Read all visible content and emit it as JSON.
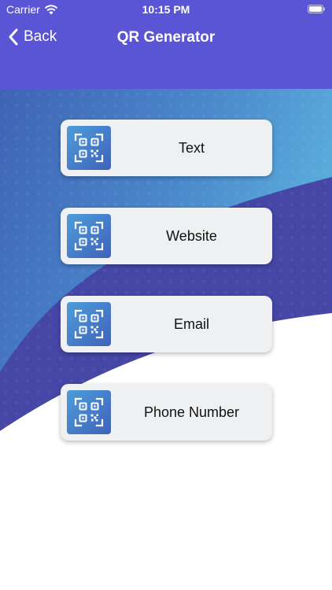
{
  "status_bar": {
    "carrier": "Carrier",
    "time": "10:15 PM",
    "icons": [
      "wifi-icon",
      "battery-icon"
    ]
  },
  "nav": {
    "back_label": "Back",
    "title": "QR Generator",
    "back_icon": "chevron-left-icon"
  },
  "colors": {
    "header": "#5a55d5",
    "wave_light": "#4a86cc",
    "wave_dark": "#4747a6",
    "card_background": "#eef0f2",
    "qr_tile_gradient": [
      "#4d9dd9",
      "#3f62ba"
    ]
  },
  "options": [
    {
      "label": "Text",
      "icon": "qr-code-icon"
    },
    {
      "label": "Website",
      "icon": "qr-code-icon"
    },
    {
      "label": "Email",
      "icon": "qr-code-icon"
    },
    {
      "label": "Phone Number",
      "icon": "qr-code-icon"
    }
  ]
}
